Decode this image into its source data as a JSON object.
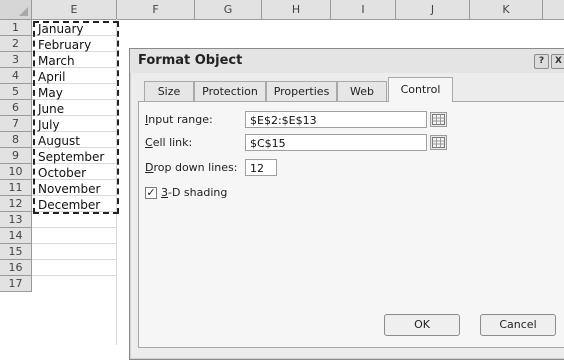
{
  "spreadsheet": {
    "columns": [
      "E",
      "F",
      "G",
      "H",
      "I",
      "J",
      "K"
    ],
    "rows": [
      "1",
      "2",
      "3",
      "4",
      "5",
      "6",
      "7",
      "8",
      "9",
      "10",
      "11",
      "12",
      "13",
      "14",
      "15",
      "16",
      "17"
    ],
    "cells": [
      "January",
      "February",
      "March",
      "April",
      "May",
      "June",
      "July",
      "August",
      "September",
      "October",
      "November",
      "December"
    ]
  },
  "dialog": {
    "title": "Format Object",
    "help_glyph": "?",
    "close_glyph": "X",
    "tabs": [
      "Size",
      "Protection",
      "Properties",
      "Web",
      "Control"
    ],
    "active_tab": "Control",
    "input_range_label": "Input range:",
    "input_range_value": "$E$2:$E$13",
    "cell_link_label": "Cell link:",
    "cell_link_value": "$C$15",
    "drop_down_lines_label": "Drop down lines:",
    "drop_down_lines_value": "12",
    "shading_label": "3-D shading",
    "shading_checked": true,
    "check_glyph": "✓",
    "ok_label": "OK",
    "cancel_label": "Cancel"
  }
}
